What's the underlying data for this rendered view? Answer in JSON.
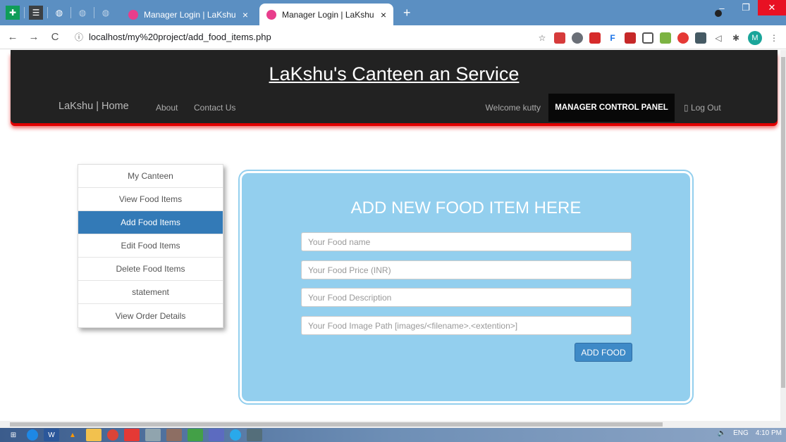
{
  "browser": {
    "tabs": [
      {
        "title": "Manager Login | LaKshu",
        "active": false
      },
      {
        "title": "Manager Login | LaKshu",
        "active": true
      }
    ],
    "new_tab": "+",
    "url": "localhost/my%20project/add_food_items.php",
    "profile_initial": "M"
  },
  "header": {
    "site_title": "LaKshu's Canteen an Service",
    "brand": "LaKshu | Home",
    "nav": {
      "about": "About",
      "contact": "Contact Us"
    },
    "welcome": "Welcome kutty",
    "control_panel": "MANAGER CONTROL PANEL",
    "logout": "Log Out"
  },
  "sidebar": {
    "items": [
      {
        "label": "My Canteen",
        "active": false
      },
      {
        "label": "View Food Items",
        "active": false
      },
      {
        "label": "Add Food Items",
        "active": true
      },
      {
        "label": "Edit Food Items",
        "active": false
      },
      {
        "label": "Delete Food Items",
        "active": false
      },
      {
        "label": "statement",
        "active": false
      },
      {
        "label": "View Order Details",
        "active": false
      }
    ]
  },
  "form": {
    "title": "ADD NEW FOOD ITEM HERE",
    "name_placeholder": "Your Food name",
    "price_placeholder": "Your Food Price (INR)",
    "description_placeholder": "Your Food Description",
    "image_placeholder": "Your Food Image Path [images/<filename>.<extention>]",
    "submit_label": "ADD FOOD"
  },
  "taskbar": {
    "language": "ENG",
    "time": "4:10 PM"
  },
  "colors": {
    "navbar_bg": "#222222",
    "header_shadow": "#e00000",
    "active_menu": "#337ab7",
    "form_bg": "#93cfee",
    "button_bg": "#3e8ac7",
    "tabstrip": "#5b8fc2"
  }
}
